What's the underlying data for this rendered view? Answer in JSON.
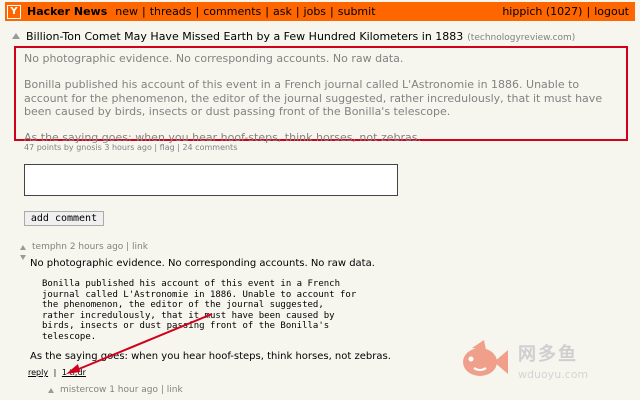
{
  "header": {
    "logo": "Y",
    "site_name": "Hacker News",
    "nav": [
      "new",
      "threads",
      "comments",
      "ask",
      "jobs",
      "submit"
    ],
    "user": "hippich (1027)",
    "logout": "logout"
  },
  "story": {
    "title": "Billion-Ton Comet May Have Missed Earth by a Few Hundred Kilometers in 1883",
    "domain": "(technologyreview.com)",
    "text": [
      "No photographic evidence. No corresponding accounts. No raw data.",
      "Bonilla published his account of this event in a French journal called L'Astronomie in 1886. Unable to account for the phenomenon, the editor of the journal suggested, rather incredulously, that it must have been caused by birds, insects or dust passing front of the Bonilla's telescope.",
      "As the saying goes: when you hear hoof-steps, think horses, not zebras."
    ],
    "subtext": "47 points by gnosis 3 hours ago | flag | 24 comments"
  },
  "form": {
    "add_comment_label": "add comment"
  },
  "comment": {
    "head": "temphn 2 hours ago | link",
    "p1": "No photographic evidence. No corresponding accounts. No raw data.",
    "pre": "Bonilla published his account of this event in a French\njournal called L'Astronomie in 1886. Unable to account for\nthe phenomenon, the editor of the journal suggested,\nrather incredulously, that it must have been caused by\nbirds, insects or dust passing front of the Bonilla's\ntelescope.",
    "p2": "As the saying goes: when you hear hoof-steps, think horses, not zebras.",
    "reply": "reply",
    "sep": "|",
    "tldr": "1 tl;dr"
  },
  "child_comment": {
    "head": "mistercow 1 hour ago | link"
  },
  "watermark": {
    "cn": "网多鱼",
    "url": "wduoyu.com"
  },
  "colors": {
    "header_bg": "#ff6600",
    "page_bg": "#f6f6ef",
    "highlight_border": "#d0021b",
    "muted_text": "#828282"
  }
}
